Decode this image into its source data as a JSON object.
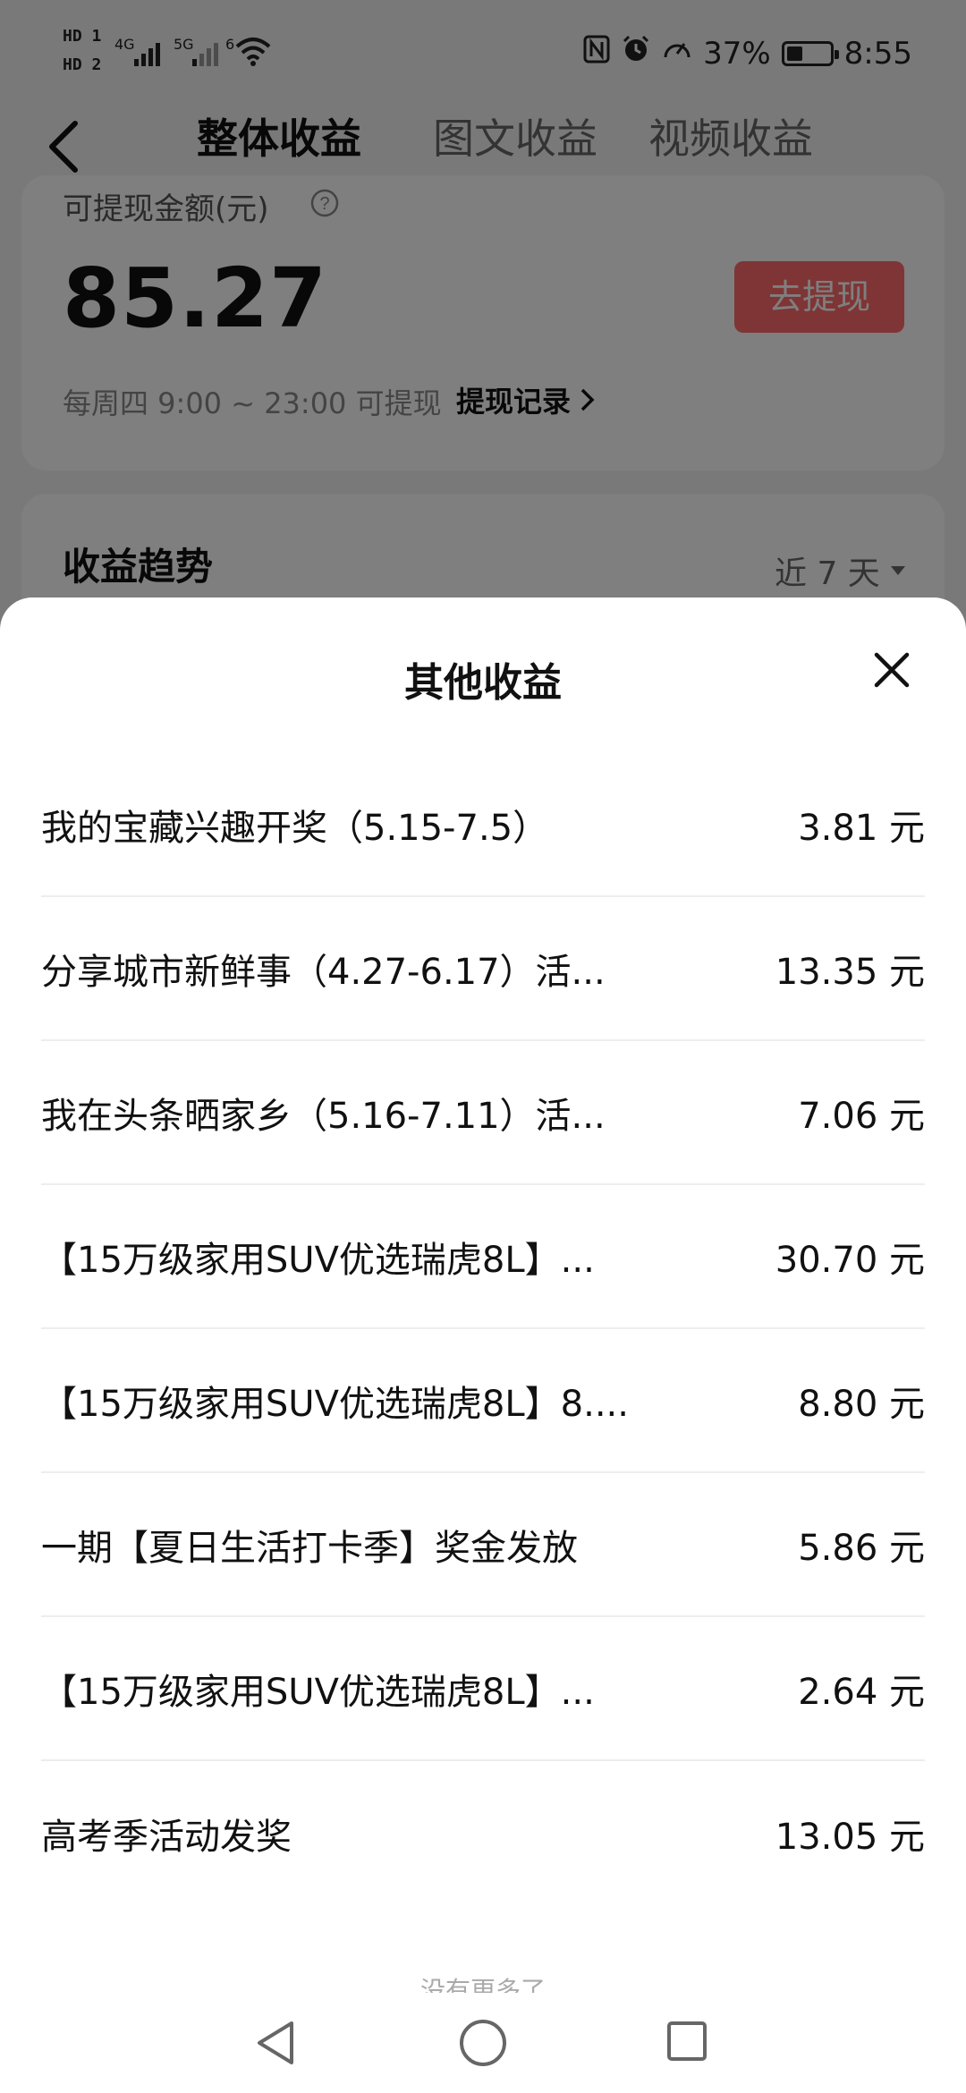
{
  "status_bar": {
    "sim1": "HD 1",
    "sim2": "HD 2",
    "signal1": "4G",
    "signal2": "5G",
    "wifi_label": "6",
    "battery_percent": "37%",
    "battery_level": 0.37,
    "time": "8:55"
  },
  "tabs": [
    {
      "label": "整体收益",
      "active": true
    },
    {
      "label": "图文收益",
      "active": false
    },
    {
      "label": "视频收益",
      "active": false
    }
  ],
  "balance_card": {
    "label": "可提现金额(元)",
    "amount": "85.27",
    "withdraw_button": "去提现",
    "schedule": "每周四 9:00 ~ 23:00 可提现",
    "records_link": "提现记录"
  },
  "trend_card": {
    "title": "收益趋势",
    "range": "近 7 天"
  },
  "sheet": {
    "title": "其他收益",
    "items": [
      {
        "name": "我的宝藏兴趣开奖（5.15-7.5）",
        "value": "3.81 元"
      },
      {
        "name": "分享城市新鲜事（4.27-6.17）活...",
        "value": "13.35 元"
      },
      {
        "name": "我在头条晒家乡（5.16-7.11）活...",
        "value": "7.06 元"
      },
      {
        "name": "【15万级家用SUV优选瑞虎8L】...",
        "value": "30.70 元"
      },
      {
        "name": "【15万级家用SUV优选瑞虎8L】8....",
        "value": "8.80 元"
      },
      {
        "name": "一期【夏日生活打卡季】奖金发放",
        "value": "5.86 元"
      },
      {
        "name": "【15万级家用SUV优选瑞虎8L】...",
        "value": "2.64 元"
      },
      {
        "name": "高考季活动发奖",
        "value": "13.05 元"
      }
    ],
    "footer": "没有更多了"
  },
  "colors": {
    "accent": "#ff6a6a",
    "overlay": "rgba(0,0,0,0.5)"
  }
}
